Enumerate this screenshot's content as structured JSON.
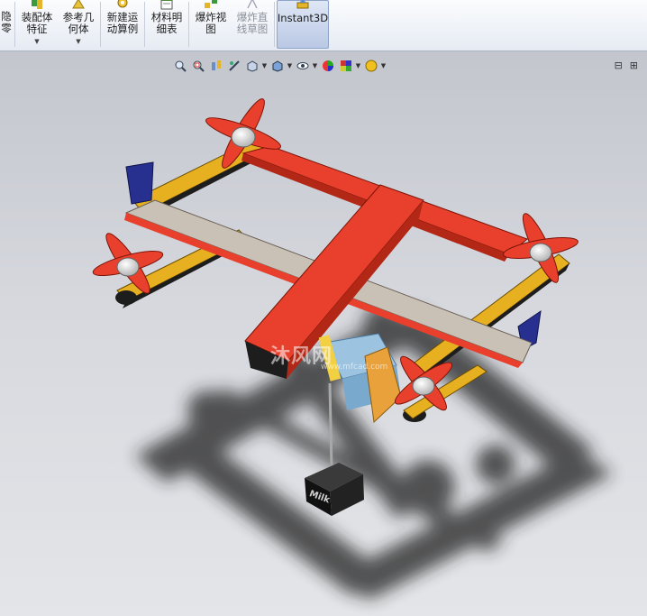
{
  "ribbon": {
    "partial_label_top": "隐",
    "partial_label_bottom": "零",
    "buttons": [
      {
        "line1": "装配体",
        "line2": "特征",
        "has_dropdown": true,
        "icon": "assembly-features-icon"
      },
      {
        "line1": "参考几",
        "line2": "何体",
        "has_dropdown": true,
        "icon": "reference-geometry-icon"
      },
      {
        "line1": "新建运",
        "line2": "动算例",
        "has_dropdown": false,
        "icon": "motion-study-icon"
      },
      {
        "line1": "材料明",
        "line2": "细表",
        "has_dropdown": false,
        "icon": "bill-of-materials-icon"
      },
      {
        "line1": "爆炸视",
        "line2": "图",
        "has_dropdown": false,
        "icon": "exploded-view-icon"
      },
      {
        "line1": "爆炸直",
        "line2": "线草图",
        "has_dropdown": false,
        "icon": "explode-line-sketch-icon",
        "disabled": true
      },
      {
        "line1": "Instant3D",
        "line2": "",
        "has_dropdown": false,
        "icon": "instant3d-icon",
        "active": true
      }
    ]
  },
  "view_toolbar": {
    "icons": [
      "zoom-to-fit-icon",
      "zoom-to-area-icon",
      "previous-view-icon",
      "section-view-icon",
      "view-orientation-icon",
      "display-style-icon",
      "hide-show-items-icon",
      "edit-appearance-icon",
      "apply-scene-icon",
      "view-settings-icon"
    ]
  },
  "window_controls": {
    "restore": "⊟",
    "tile": "⊞"
  },
  "watermark": {
    "text": "沐风网",
    "url": "www.mfcad.com"
  },
  "model": {
    "payload_label": "Milk",
    "colors": {
      "wing": "#c9c1b6",
      "body_red": "#e8402c",
      "boom_yellow": "#e6b021",
      "boom_black": "#1d1d1d",
      "fin_blue": "#27308e",
      "hub_white": "#f2f2f2",
      "box_blue": "#9cc3e0",
      "box_orange": "#e9a23b"
    }
  }
}
